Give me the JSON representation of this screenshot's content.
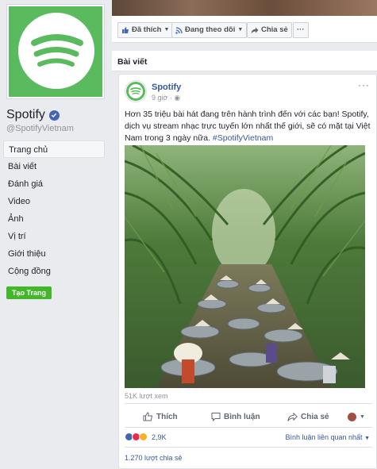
{
  "page": {
    "name": "Spotify",
    "handle": "@SpotifyVietnam",
    "brand_color": "#5aba5e"
  },
  "nav": {
    "items": [
      {
        "label": "Trang chủ",
        "active": true
      },
      {
        "label": "Bài viết"
      },
      {
        "label": "Đánh giá"
      },
      {
        "label": "Video"
      },
      {
        "label": "Ảnh"
      },
      {
        "label": "Vị trí"
      },
      {
        "label": "Giới thiệu"
      },
      {
        "label": "Cộng đồng"
      }
    ],
    "create_label": "Tạo Trang"
  },
  "actions": {
    "like": "Đã thích",
    "follow": "Đang theo dõi",
    "share": "Chia sẻ",
    "more": "···"
  },
  "section_title": "Bài viết",
  "post": {
    "author": "Spotify",
    "time": "9 giờ · ",
    "menu": "···",
    "text": "Hơn 35 triệu bài hát đang trên hành trình đến với các bạn! Spotify, dịch vụ stream nhạc trực tuyến lớn nhất thế giới, sẽ có mặt tại Việt Nam trong 3 ngày nữa. ",
    "hashtag": "#SpotifyVietnam",
    "views": "51K lượt xem",
    "like_label": "Thích",
    "comment_label": "Bình luận",
    "share_label": "Chia sẻ",
    "reactions_count": "2,9K",
    "sort_label": "Bình luận liên quan nhất",
    "shares_count": "1.270 lượt chia sẻ"
  }
}
